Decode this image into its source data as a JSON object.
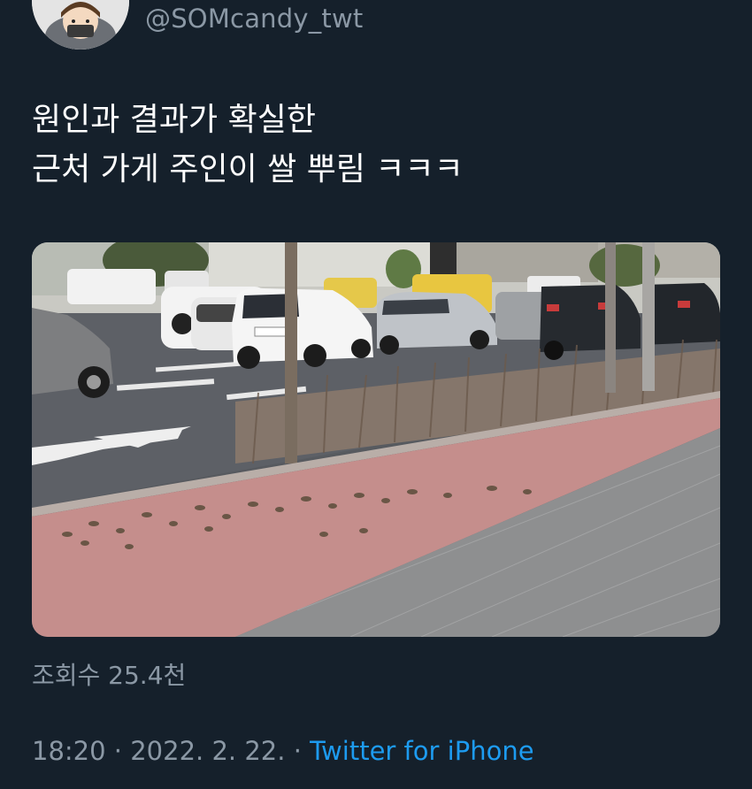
{
  "author": {
    "handle": "@SOMcandy_twt",
    "avatar_icon": "profile-avatar"
  },
  "tweet": {
    "text_line1": "원인과 결과가 확실한",
    "text_line2": "근처 가게 주인이 쌀 뿌림 ㅋㅋㅋ"
  },
  "media": {
    "kind": "photo",
    "icon": "street-photo-sparrows"
  },
  "stats": {
    "views": "조회수 25.4천"
  },
  "meta": {
    "time": "18:20",
    "separator1": " · ",
    "date": "2022. 2. 22.",
    "separator2": " · ",
    "source": "Twitter for iPhone"
  },
  "colors": {
    "background": "#15202b",
    "text_primary": "#ffffff",
    "text_secondary": "#8b98a5",
    "link": "#1d9bf0"
  }
}
